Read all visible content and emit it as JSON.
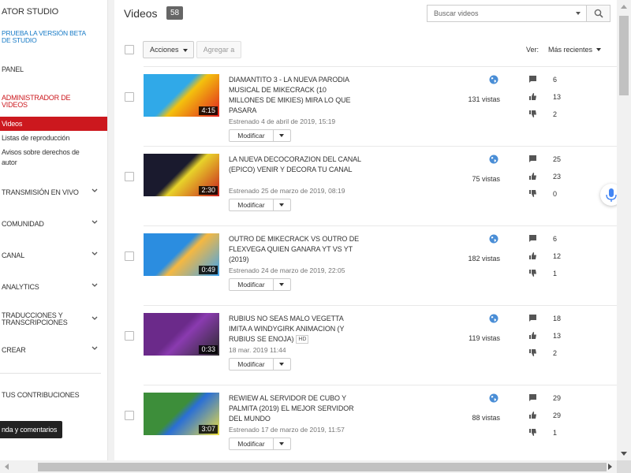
{
  "app": {
    "accent": "#cc181e",
    "link": "#167ac6"
  },
  "sidebar": {
    "title": "ATOR STUDIO",
    "beta": "PRUEBA LA VERSIÓN BETA DE STUDIO",
    "panel": "PANEL",
    "admin": "ADMINISTRADOR DE VIDEOS",
    "sub": [
      "Videos",
      "Listas de reproducción",
      "Avisos sobre derechos de autor"
    ],
    "sections": [
      "TRANSMISIÓN EN VIVO",
      "COMUNIDAD",
      "CANAL",
      "ANALYTICS",
      "TRADUCCIONES Y TRANSCRIPCIONES",
      "CREAR"
    ],
    "contrib": "TUS CONTRIBUCIONES",
    "tooltip": "nda y comentarios"
  },
  "header": {
    "title": "Videos",
    "count": "58",
    "search_placeholder": "Buscar videos"
  },
  "toolbar": {
    "actions": "Acciones",
    "add": "Agregar a",
    "view_label": "Ver:",
    "sort": "Más recientes"
  },
  "videos": [
    {
      "title": "DIAMANTITO 3 - LA NUEVA PARODIA MUSICAL DE MIKECRACK (10 MILLONES DE MIKIES) MIRA LO QUE PASARA",
      "duration": "4:15",
      "date": "Estrenado 4 de abril de 2019, 15:19",
      "hd": "",
      "views": "131 vistas",
      "comments": "6",
      "likes": "13",
      "dislikes": "2",
      "edit": "Modificar",
      "thumb_colors": [
        "#30a9e8",
        "#f4c20d",
        "#e02020"
      ]
    },
    {
      "title": "LA NUEVA DECOCORAZION DEL CANAL (EPICO) VENIR Y DECORA TU CANAL",
      "duration": "2:30",
      "date": "Estrenado 25 de marzo de 2019, 08:19",
      "hd": "",
      "views": "75 vistas",
      "comments": "25",
      "likes": "23",
      "dislikes": "0",
      "edit": "Modificar",
      "thumb_colors": [
        "#1a1a2e",
        "#e8d32a",
        "#c81e1e"
      ]
    },
    {
      "title": "OUTRO DE MIKECRACK VS OUTRO DE FLEXVEGA QUIEN GANARA YT VS YT (2019)",
      "duration": "0:49",
      "date": "Estrenado 24 de marzo de 2019, 22:05",
      "hd": "",
      "views": "182 vistas",
      "comments": "6",
      "likes": "12",
      "dislikes": "1",
      "edit": "Modificar",
      "thumb_colors": [
        "#2b8de0",
        "#f5b841",
        "#3ea4f0"
      ]
    },
    {
      "title": "RUBIUS NO SEAS MALO VEGETTA IMITA A WINDYGIRK ANIMACION (Y RUBIUS SE ENOJA)",
      "duration": "0:33",
      "date": "18 mar. 2019 11:44",
      "hd": "HD",
      "views": "119 vistas",
      "comments": "18",
      "likes": "13",
      "dislikes": "2",
      "edit": "Modificar",
      "thumb_colors": [
        "#6b2a8a",
        "#8a3bb0",
        "#2a2a2a"
      ]
    },
    {
      "title": "REWIEW AL SERVIDOR DE CUBO Y PALMITA (2019) EL MEJOR SERVIDOR DEL MUNDO",
      "duration": "3:07",
      "date": "Estrenado 17 de marzo de 2019, 11:57",
      "hd": "",
      "views": "88 vistas",
      "comments": "29",
      "likes": "29",
      "dislikes": "1",
      "edit": "Modificar",
      "thumb_colors": [
        "#3d8e3a",
        "#2a6fd6",
        "#f0e040"
      ]
    }
  ]
}
